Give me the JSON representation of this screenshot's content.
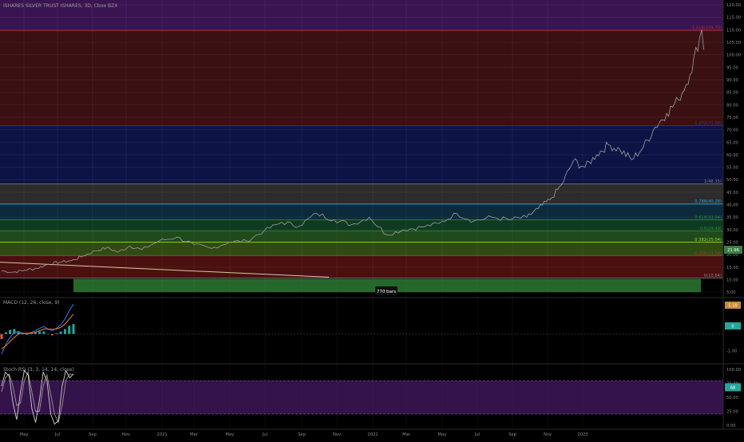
{
  "header": {
    "symbol_title": "ISHARES SILVER TRUST ISHARES, 3D, Cboe BZX",
    "macd_title": "MACD (12, 26, close, 9)",
    "stoch_title": "Stoch RSI (3, 3, 14, 14, close)"
  },
  "colors": {
    "background": "#000000",
    "price_line": "#9e9e9e",
    "trendline": "#d9c7a0",
    "fib_red": "#b03030",
    "fib_blue": "#2b3fa8",
    "fib_gray": "#7f7f7f",
    "fib_teal": "#2a9fd0",
    "fib_green": "#2e8b3c",
    "fib_lime": "#9fd42b",
    "purple_zone": "#3a1450",
    "measure_box": "#3aa043",
    "macd_line": "#2e7cf6",
    "signal_line": "#f57c24",
    "hist_pos": "#26a69a",
    "hist_neg": "#ef5350",
    "stoch_k": "#d0d0d0",
    "stoch_d": "#9a9a9a",
    "stoch_band": "#4a1a6a"
  },
  "chart_data": [
    {
      "type": "line",
      "name": "price",
      "ylim": [
        5,
        120
      ],
      "yticks": [
        "120.00",
        "115.00",
        "110.00",
        "105.00",
        "100.00",
        "95.00",
        "90.00",
        "85.00",
        "80.00",
        "75.00",
        "70.00",
        "65.00",
        "60.00",
        "55.00",
        "50.00",
        "45.00",
        "40.00",
        "35.00",
        "30.00",
        "25.00",
        "20.00",
        "15.00",
        "10.00",
        "5.00"
      ],
      "xticks": [
        "May",
        "Jul",
        "Sep",
        "Nov",
        "2021",
        "Mar",
        "May",
        "Jul",
        "Sep",
        "Nov",
        "2022",
        "Mar",
        "May",
        "Jul",
        "Sep",
        "Nov",
        "2023"
      ],
      "x": [
        0,
        2,
        4,
        6,
        8,
        10,
        12,
        14,
        16,
        18,
        20,
        22,
        24,
        27,
        30,
        33,
        36,
        39,
        42,
        45,
        48,
        51,
        54,
        57,
        60,
        63,
        66,
        69,
        72,
        75,
        78,
        81,
        84,
        87,
        90,
        92,
        94,
        96,
        98,
        100,
        102,
        104,
        106,
        108,
        110,
        112,
        114,
        116,
        118,
        120
      ],
      "values": [
        13.5,
        13.0,
        13.8,
        14.5,
        16.2,
        17.0,
        17.6,
        19.5,
        21.5,
        22.8,
        21.0,
        23.5,
        22.0,
        25.5,
        27.0,
        24.0,
        22.5,
        25.0,
        25.5,
        29.5,
        33.0,
        31.5,
        36.5,
        34.0,
        32.0,
        35.0,
        28.0,
        30.0,
        31.0,
        32.5,
        36.5,
        33.5,
        35.0,
        34.0,
        35.0,
        38.5,
        42.0,
        48.0,
        57.5,
        55.0,
        60.0,
        64.0,
        62.0,
        58.0,
        63.0,
        71.0,
        76.5,
        82.0,
        92.0,
        110.0
      ],
      "fib_levels": [
        {
          "label": "1.618(109.73)",
          "value": 109.73
        },
        {
          "label": "1.272(71.68)",
          "value": 71.68
        },
        {
          "label": "1(48.35)",
          "value": 48.35
        },
        {
          "label": "0.786(40.28)",
          "value": 40.28
        },
        {
          "label": "0.618(33.94)",
          "value": 33.94
        },
        {
          "label": "0.5(29.49)",
          "value": 29.49
        },
        {
          "label": "0.382(25.04)",
          "value": 25.04
        },
        {
          "label": "0.236(19.54)",
          "value": 19.54
        },
        {
          "label": "0(10.64)",
          "value": 10.64
        }
      ],
      "last_price_badge": "21.96",
      "measure_label": "770 bars"
    },
    {
      "type": "line",
      "name": "MACD",
      "ylim": [
        -1.6,
        2.0
      ],
      "yticks": [
        "-1.00"
      ],
      "macd": [
        -1.2,
        -0.6,
        -0.2,
        0.1,
        0.15,
        0.05,
        0.0,
        0.1,
        0.2,
        0.35,
        0.45,
        0.3,
        0.2,
        0.35,
        0.55,
        0.9,
        1.4,
        1.8
      ],
      "signal": [
        -0.9,
        -0.7,
        -0.45,
        -0.2,
        0.0,
        0.05,
        0.05,
        0.05,
        0.1,
        0.2,
        0.3,
        0.3,
        0.28,
        0.3,
        0.4,
        0.6,
        0.9,
        1.2
      ],
      "histogram": [
        -0.3,
        0.1,
        0.25,
        0.3,
        0.15,
        0.0,
        -0.05,
        0.05,
        0.1,
        0.15,
        0.15,
        0.0,
        -0.08,
        0.05,
        0.15,
        0.3,
        0.5,
        0.6
      ],
      "right_badges": [
        "5.18",
        "0"
      ]
    },
    {
      "type": "line",
      "name": "Stoch RSI",
      "ylim": [
        0,
        100
      ],
      "yticks": [
        "100.00",
        "75.00",
        "50.00",
        "25.00",
        "0.00"
      ],
      "band": [
        20,
        80
      ],
      "k": [
        70,
        95,
        88,
        40,
        10,
        60,
        98,
        90,
        30,
        5,
        45,
        95,
        80,
        20,
        2,
        8,
        70,
        98,
        85,
        92
      ],
      "d": [
        60,
        85,
        92,
        70,
        35,
        40,
        80,
        95,
        60,
        25,
        25,
        70,
        90,
        55,
        20,
        5,
        35,
        80,
        92,
        90
      ],
      "right_badge": "68"
    }
  ]
}
